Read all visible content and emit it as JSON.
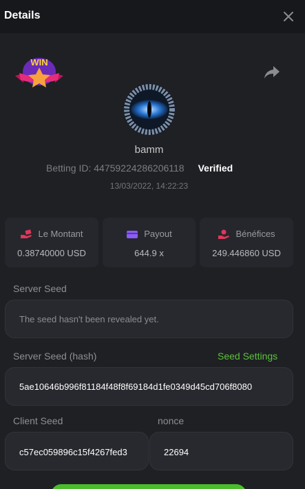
{
  "header": {
    "title": "Details",
    "close_icon": "close-icon"
  },
  "badge": {
    "text": "WIN"
  },
  "user": {
    "name": "bamm",
    "betting_id": "Betting ID: 44759224286206118",
    "verified": "Verified",
    "datetime": "13/03/2022, 14:22:23"
  },
  "stats": [
    {
      "label": "Le Montant",
      "value": "0.38740000 USD",
      "icon": "money-hand-icon",
      "color": "#e0375a"
    },
    {
      "label": "Payout",
      "value": "644.9 x",
      "icon": "wallet-icon",
      "color": "#8b5cf6"
    },
    {
      "label": "Bénéfices",
      "value": "249.446860 USD",
      "icon": "profit-hand-icon",
      "color": "#e0375a"
    }
  ],
  "server_seed": {
    "label": "Server Seed",
    "value": "The seed hasn't been revealed yet."
  },
  "server_seed_hash": {
    "label": "Server Seed (hash)",
    "link": "Seed Settings",
    "value": "5ae10646b996f81184f48f8f69184d1fe0349d45cd706f8080"
  },
  "client_seed": {
    "label": "Client Seed",
    "value": "c57ec059896c15f4267fed3"
  },
  "nonce": {
    "label": "nonce",
    "value": "22694"
  },
  "colors": {
    "accent_green": "#5bc33a",
    "background": "#1f2024",
    "header": "#17181b"
  }
}
